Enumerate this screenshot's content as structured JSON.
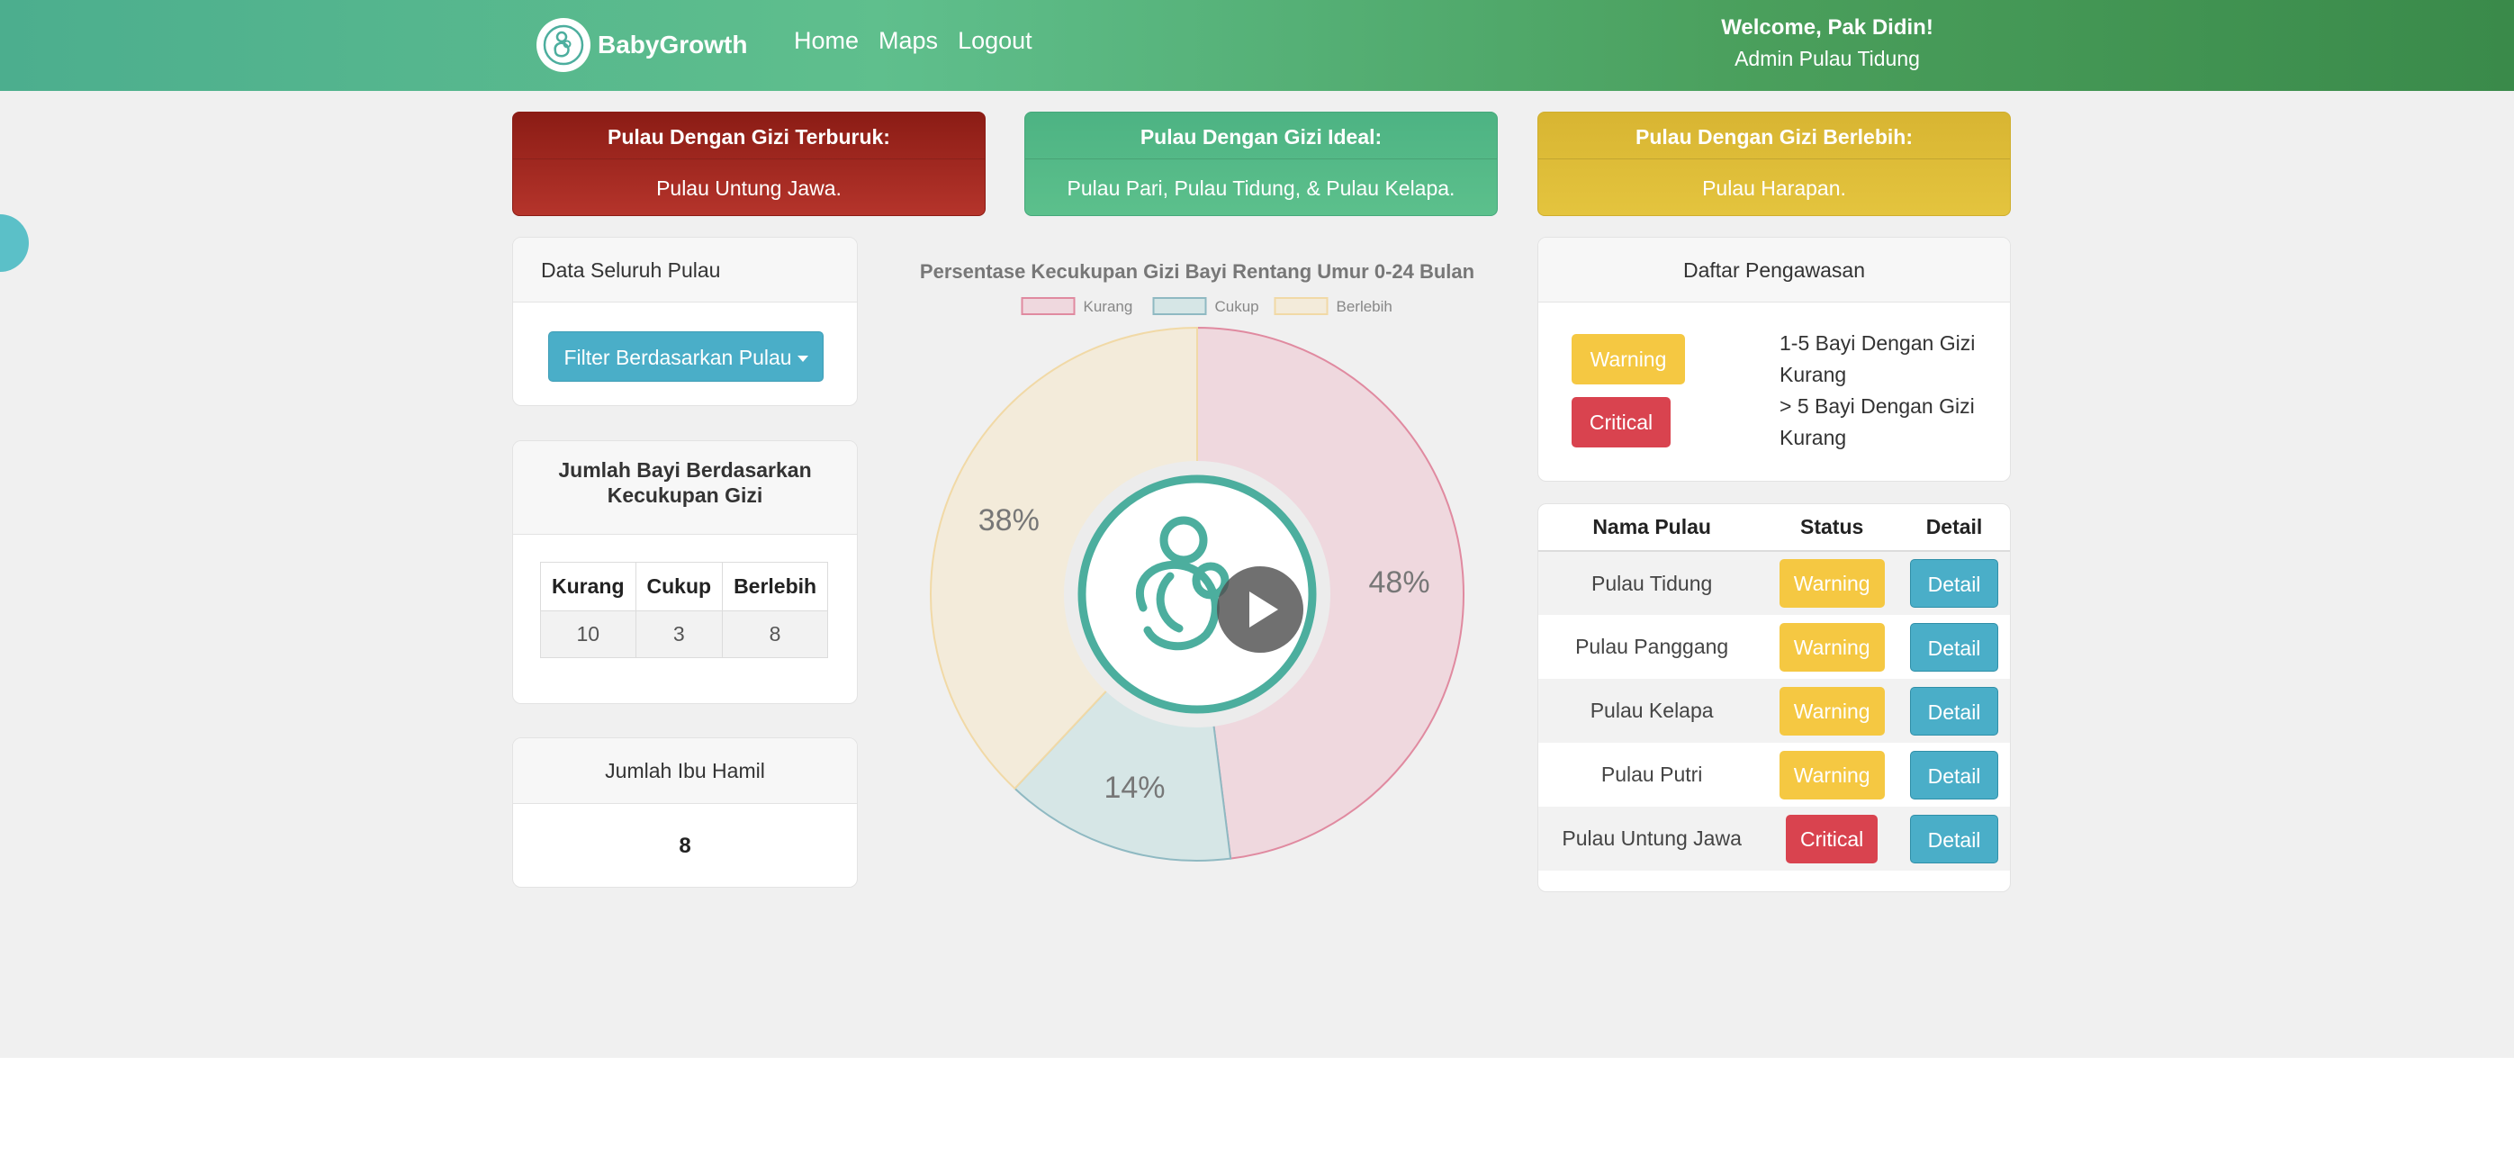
{
  "navbar": {
    "brand": "BabyGrowth",
    "links": [
      "Home",
      "Maps",
      "Logout"
    ],
    "welcome": "Welcome, Pak Didin!",
    "role": "Admin Pulau Tidung"
  },
  "alerts": {
    "worst": {
      "title": "Pulau Dengan Gizi Terburuk:",
      "text": "Pulau Untung Jawa."
    },
    "ideal": {
      "title": "Pulau Dengan Gizi Ideal:",
      "text": "Pulau Pari, Pulau Tidung, & Pulau Kelapa."
    },
    "excess": {
      "title": "Pulau Dengan Gizi Berlebih:",
      "text": "Pulau Harapan."
    }
  },
  "data_card": {
    "title": "Data Seluruh Pulau",
    "filter_label": "Filter Berdasarkan Pulau"
  },
  "jumlah_card": {
    "title": "Jumlah Bayi Berdasarkan Kecukupan Gizi",
    "headers": [
      "Kurang",
      "Cukup",
      "Berlebih"
    ],
    "values": [
      "10",
      "3",
      "8"
    ]
  },
  "ibu_card": {
    "title": "Jumlah Ibu Hamil",
    "value": "8"
  },
  "chart_data": {
    "type": "pie",
    "title": "Persentase Kecukupan Gizi Bayi Rentang Umur 0-24 Bulan",
    "categories": [
      "Kurang",
      "Cukup",
      "Berlebih"
    ],
    "values": [
      48,
      14,
      38
    ],
    "labels": [
      "48%",
      "14%",
      "38%"
    ],
    "colors": [
      "#efd8de",
      "#d6e6e6",
      "#f3ebda"
    ],
    "stroke_colors": [
      "#e08aa0",
      "#8fb9c2",
      "#f1d9a6"
    ],
    "legend_position": "top"
  },
  "pengawasan": {
    "title": "Daftar Pengawasan",
    "warning_label": "Warning",
    "critical_label": "Critical",
    "warning_desc": "1-5 Bayi Dengan Gizi Kurang",
    "critical_desc": "> 5 Bayi Dengan Gizi Kurang"
  },
  "status_table": {
    "headers": [
      "Nama Pulau",
      "Status",
      "Detail"
    ],
    "rows": [
      {
        "name": "Pulau Tidung",
        "status": "Warning",
        "detail": "Detail"
      },
      {
        "name": "Pulau Panggang",
        "status": "Warning",
        "detail": "Detail"
      },
      {
        "name": "Pulau Kelapa",
        "status": "Warning",
        "detail": "Detail"
      },
      {
        "name": "Pulau Putri",
        "status": "Warning",
        "detail": "Detail"
      },
      {
        "name": "Pulau Untung Jawa",
        "status": "Critical",
        "detail": "Detail"
      }
    ]
  },
  "colors": {
    "accent": "#4aaec8",
    "warning": "#f5c842",
    "critical": "#d9434f",
    "nav_start": "#4cae8e",
    "nav_end": "#3a8a4a"
  }
}
